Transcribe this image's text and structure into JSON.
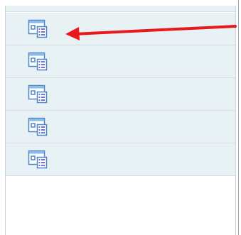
{
  "list": {
    "items": [
      {
        "icon": "form-list-icon"
      },
      {
        "icon": "form-list-icon"
      },
      {
        "icon": "form-list-icon"
      },
      {
        "icon": "form-list-icon"
      },
      {
        "icon": "form-list-icon"
      }
    ]
  },
  "annotation": {
    "arrow_color": "#e8181b"
  },
  "colors": {
    "row_background": "#e8f1f3",
    "row_border": "#d5dde1",
    "icon_frame": "#4d86c6",
    "icon_header": "#8cb8e8",
    "icon_list": "#6f74c9"
  }
}
